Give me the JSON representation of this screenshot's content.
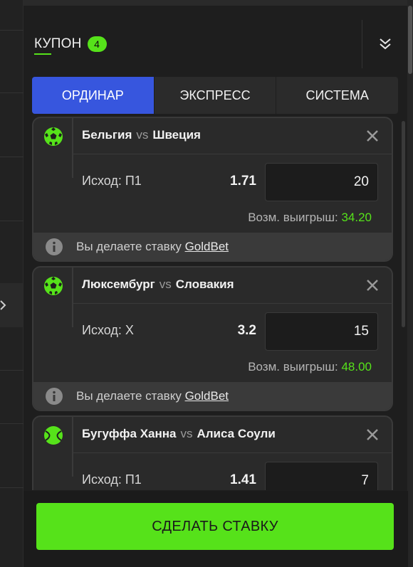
{
  "coupon": {
    "title": "КУПОН",
    "count": "4"
  },
  "tabs": [
    {
      "label": "ОРДИНАР",
      "active": true
    },
    {
      "label": "ЭКСПРЕСС",
      "active": false
    },
    {
      "label": "СИСТЕМА",
      "active": false
    }
  ],
  "bets": [
    {
      "sport": "football",
      "team1": "Бельгия",
      "vs": "vs",
      "team2": "Швеция",
      "outcome": "Исход: П1",
      "odds": "1.71",
      "stake": "20",
      "win_label": "Возм. выигрыш:",
      "win_value": "34.20",
      "info_text": "Вы делаете ставку",
      "info_link": "GoldBet"
    },
    {
      "sport": "football",
      "team1": "Люксембург",
      "vs": "vs",
      "team2": "Словакия",
      "outcome": "Исход: X",
      "odds": "3.2",
      "stake": "15",
      "win_label": "Возм. выигрыш:",
      "win_value": "48.00",
      "info_text": "Вы делаете ставку",
      "info_link": "GoldBet"
    },
    {
      "sport": "tennis",
      "team1": "Бугуффа Ханна",
      "vs": "vs",
      "team2": "Алиса Соули",
      "outcome": "Исход: П1",
      "odds": "1.41",
      "stake": "7"
    }
  ],
  "submit_label": "СДЕЛАТЬ СТАВКУ",
  "colors": {
    "accent_green": "#56e21a",
    "tab_active": "#3756de"
  },
  "icons": {
    "football": "soccer-ball-icon",
    "tennis": "tennis-ball-icon",
    "close": "close-icon",
    "info": "info-icon",
    "collapse": "double-chevron-down-icon"
  }
}
